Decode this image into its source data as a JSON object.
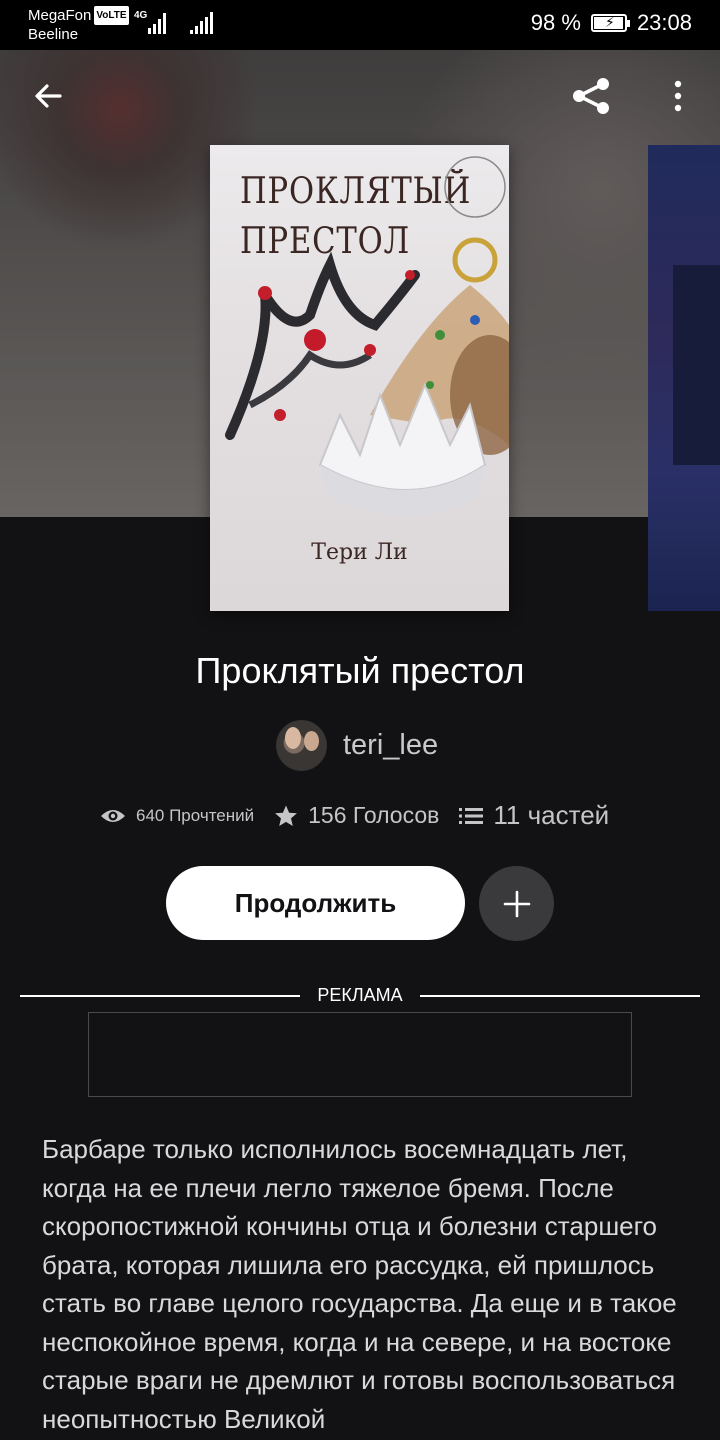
{
  "status_bar": {
    "carrier_1": "MegaFon",
    "volte": "VoLTE",
    "network": "4G",
    "carrier_2": "Beeline",
    "battery_pct": "98 %",
    "battery_level": 0.98,
    "time": "23:08"
  },
  "toolbar": {
    "back_icon": "arrow-left-icon",
    "share_icon": "share-icon",
    "more_icon": "more-vertical-icon"
  },
  "cover": {
    "title_line1": "ПРОКЛЯТЫЙ",
    "title_line2": "ПРЕСТОЛ",
    "author": "Тери Ли"
  },
  "story": {
    "title": "Проклятый престол",
    "author": "teri_lee",
    "reads": "640 Прочтений",
    "votes": "156 Голосов",
    "parts": "11 частей",
    "continue_label": "Продолжить",
    "ad_label": "РЕКЛАМА",
    "description": "Барбаре только исполнилось восемнадцать лет, когда на ее плечи легло тяжелое бремя. После скоропостижной кончины отца и болезни старшего брата, которая лишила его рассудка, ей пришлось стать во главе целого государства. Да еще и в такое неспокойное время, когда и на севере, и на востоке старые враги не дремлют и готовы воспользоваться неопытностью Великой"
  },
  "colors": {
    "background": "#121214",
    "button_primary": "#ffffff",
    "button_secondary": "#3a3a3d",
    "text_secondary": "#c5c5c8"
  }
}
